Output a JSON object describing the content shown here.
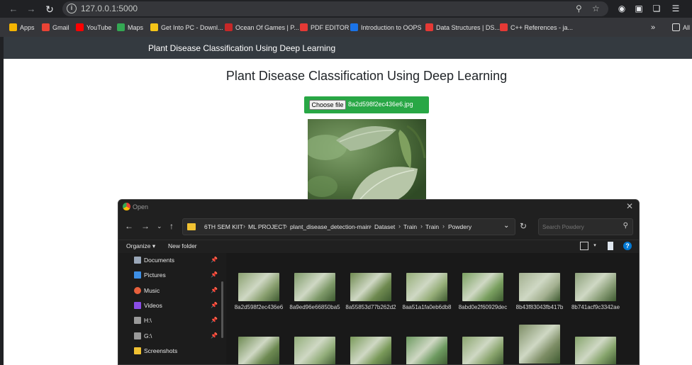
{
  "browser": {
    "url": "127.0.0.1:5000",
    "bookmarks": [
      {
        "label": "Apps",
        "color": "#f4b400"
      },
      {
        "label": "Gmail",
        "color": "#ea4335"
      },
      {
        "label": "YouTube",
        "color": "#ff0000"
      },
      {
        "label": "Maps",
        "color": "#34a853"
      },
      {
        "label": "Get Into PC - Downl...",
        "color": "#f5c518"
      },
      {
        "label": "Ocean Of Games | P...",
        "color": "#c62828"
      },
      {
        "label": "PDF EDITOR",
        "color": "#e53935"
      },
      {
        "label": "Introduction to OOPS",
        "color": "#1a73e8"
      },
      {
        "label": "Data Structures | DS...",
        "color": "#e53935"
      },
      {
        "label": "C++ References - ja...",
        "color": "#e53935"
      }
    ],
    "more": "»",
    "all_bookmarks": "All"
  },
  "navbar": {
    "brand": "Plant Disease Classification Using Deep Learning"
  },
  "page": {
    "title": "Plant Disease Classification Using Deep Learning",
    "choose_file": "Choose file",
    "file_name": "8a2d598f2ec436e6.jpg"
  },
  "dialog": {
    "title": "Open",
    "path": [
      "6TH SEM KIIT",
      "ML PROJECT",
      "plant_disease_detection-main",
      "Dataset",
      "Train",
      "Train",
      "Powdery"
    ],
    "search_placeholder": "Search Powdery",
    "organize": "Organize",
    "new_folder": "New folder",
    "sidebar": [
      {
        "label": "Documents",
        "color": "#9aa7b8",
        "pinned": true
      },
      {
        "label": "Pictures",
        "color": "#3d8fe6",
        "pinned": true
      },
      {
        "label": "Music",
        "color": "#e8603c",
        "pinned": true
      },
      {
        "label": "Videos",
        "color": "#8a4de6",
        "pinned": true
      },
      {
        "label": "H:\\",
        "color": "#9a9a9a",
        "pinned": true
      },
      {
        "label": "G:\\",
        "color": "#9a9a9a",
        "pinned": true
      },
      {
        "label": "Screenshots",
        "color": "#f1c232",
        "pinned": false
      }
    ],
    "files": [
      {
        "name": "8a2d598f2ec436e6",
        "color": "#8aa070"
      },
      {
        "name": "8a9ed96e66850ba5",
        "color": "#7f9a6a"
      },
      {
        "name": "8a55853d77b262d2",
        "color": "#6f8a50"
      },
      {
        "name": "8aa51a1fa0eb6db8",
        "color": "#95ad78"
      },
      {
        "name": "8abd0e2f60929dec",
        "color": "#7aa060"
      },
      {
        "name": "8b43f83043fb417b",
        "color": "#a3b090"
      },
      {
        "name": "8b741acf9c3342ae",
        "color": "#8ca07a"
      },
      {
        "name": "",
        "color": "#6e8a52"
      },
      {
        "name": "",
        "color": "#92ad7a"
      },
      {
        "name": "",
        "color": "#7a9a5a"
      },
      {
        "name": "",
        "color": "#6d9a60"
      },
      {
        "name": "",
        "color": "#8aa56e"
      },
      {
        "name": "",
        "color": "#7e8e66"
      },
      {
        "name": "",
        "color": "#86a46c"
      }
    ]
  }
}
